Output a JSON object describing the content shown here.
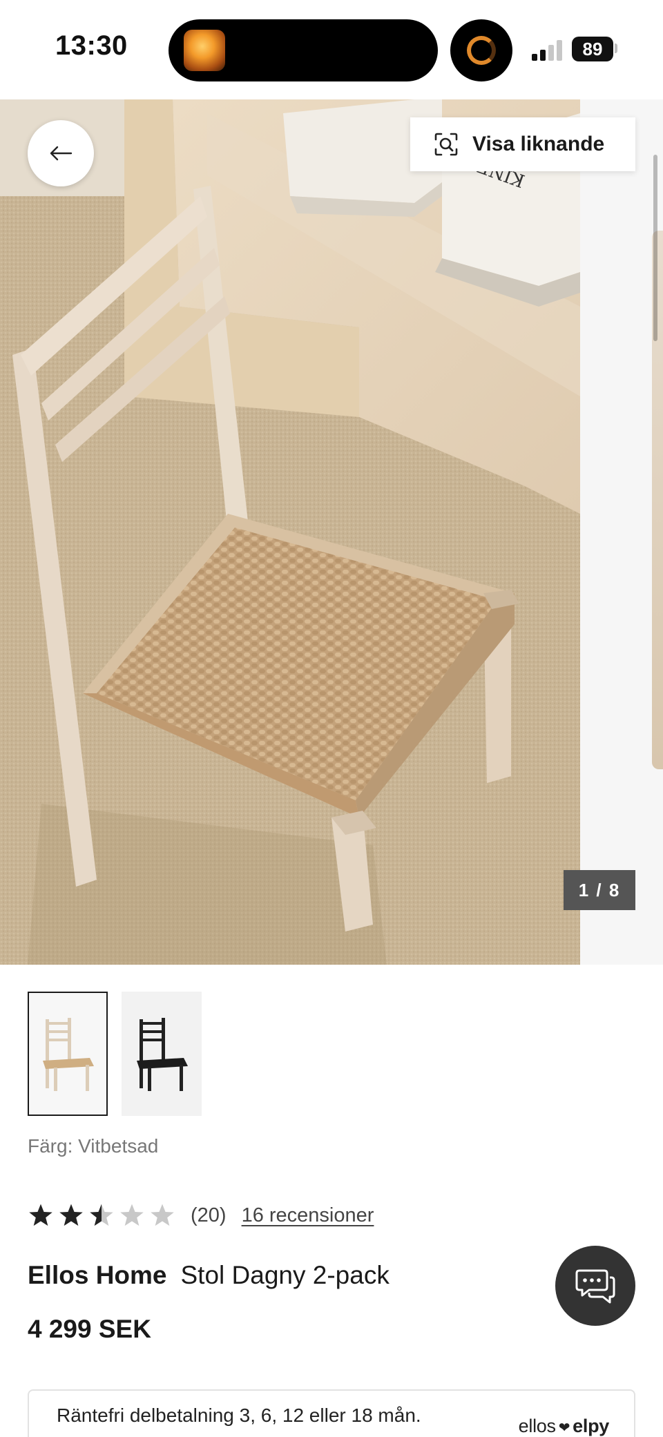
{
  "status_bar": {
    "time": "13:30",
    "battery": "89"
  },
  "gallery": {
    "visa_liknande_label": "Visa liknande",
    "counter": "1 / 8",
    "thumbnails": [
      {
        "color": "Vitbetsad",
        "selected": true
      },
      {
        "color": "Svart",
        "selected": false
      }
    ]
  },
  "product": {
    "color_label": "Färg: Vitbetsad",
    "rating": 2.5,
    "rating_max": 5,
    "rating_count": "(20)",
    "reviews_link": "16 recensioner",
    "brand": "Ellos Home",
    "name": "Stol Dagny 2-pack",
    "price": "4 299 SEK"
  },
  "finance": {
    "text": "Räntefri delbetalning 3, 6, 12 eller 18 mån.",
    "logo_left": "ellos",
    "logo_right": "elpy"
  },
  "colors": {
    "accent": "#1a1a1a",
    "counter_bg": "#555555",
    "chat_bg": "#333333"
  }
}
